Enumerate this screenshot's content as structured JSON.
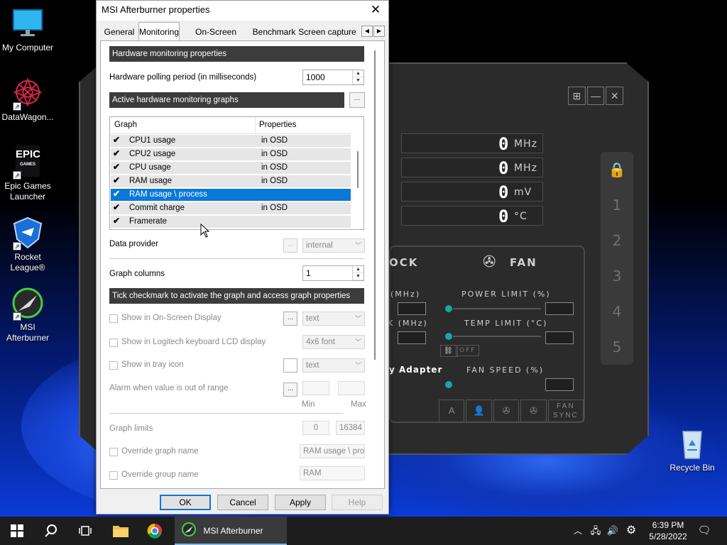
{
  "desktop": {
    "icons": [
      {
        "label": "My Computer"
      },
      {
        "label": "DataWagon..."
      },
      {
        "label": "Epic Games Launcher",
        "logo_top": "EPIC",
        "logo_bottom": "GAMES"
      },
      {
        "label": "Rocket League®"
      },
      {
        "label": "MSI Afterburner"
      },
      {
        "label": "Recycle Bin"
      }
    ]
  },
  "afterburner_skin": {
    "readouts": [
      {
        "value": "0",
        "unit": "MHz"
      },
      {
        "value": "0",
        "unit": "MHz"
      },
      {
        "value": "0",
        "unit": "mV"
      },
      {
        "value": "0",
        "unit": "°C"
      }
    ],
    "sections": {
      "clock_fragment": "OCK",
      "fan": "FAN",
      "adapter_fragment": "y Adapter"
    },
    "labels": {
      "power_limit": "POWER LIMIT (%)",
      "temp_limit": "TEMP LIMIT (°C)",
      "fan_speed": "FAN SPEED (%)",
      "mhz1": "(MHz)",
      "mhz2": "K (MHz)",
      "off": "OFF",
      "fan_sync": "FAN SYNC"
    },
    "profiles": [
      "1",
      "2",
      "3",
      "4",
      "5"
    ],
    "icon_buttons": [
      "A",
      "user-icon",
      "fan1-icon",
      "fan2-icon"
    ]
  },
  "dialog": {
    "title": "MSI Afterburner properties",
    "tabs": [
      "General",
      "Monitoring",
      "On-Screen Display",
      "Benchmark",
      "Screen capture"
    ],
    "active_tab": "Monitoring",
    "hardware_monitoring_header": "Hardware monitoring properties",
    "polling_label": "Hardware polling period (in milliseconds)",
    "polling_value": "1000",
    "active_graphs_header": "Active hardware monitoring graphs",
    "ellipsis": "...",
    "list": {
      "columns": [
        "Graph",
        "Properties"
      ],
      "rows": [
        {
          "name": "CPU1 usage",
          "prop": "in OSD",
          "checked": true
        },
        {
          "name": "CPU2 usage",
          "prop": "in OSD",
          "checked": true
        },
        {
          "name": "CPU usage",
          "prop": "in OSD",
          "checked": true
        },
        {
          "name": "RAM usage",
          "prop": "in OSD",
          "checked": true
        },
        {
          "name": "RAM usage \\ process",
          "prop": "",
          "checked": true,
          "selected": true
        },
        {
          "name": "Commit charge",
          "prop": "in OSD",
          "checked": true
        },
        {
          "name": "Framerate",
          "prop": "",
          "checked": true
        }
      ]
    },
    "data_provider_label": "Data provider",
    "data_provider_value": "internal",
    "graph_columns_label": "Graph columns",
    "graph_columns_value": "1",
    "tick_header": "Tick checkmark to activate the graph and access graph properties",
    "show_osd_label": "Show in On-Screen Display",
    "osd_type": "text",
    "show_logitech_label": "Show in Logitech keyboard LCD display",
    "logitech_font": "4x6 font",
    "show_tray_label": "Show in tray icon",
    "tray_type": "text",
    "alarm_label": "Alarm when value is out of range",
    "min_label": "Min",
    "max_label": "Max",
    "graph_limits_label": "Graph limits",
    "graph_limit_min": "0",
    "graph_limit_max": "16384",
    "override_graph_name_label": "Override graph name",
    "override_graph_name_value": "RAM usage \\ proc",
    "override_group_name_label": "Override group name",
    "override_group_name_value": "RAM",
    "buttons": {
      "ok": "OK",
      "cancel": "Cancel",
      "apply": "Apply",
      "help": "Help"
    }
  },
  "taskbar": {
    "active_app": "MSI Afterburner",
    "time": "6:39 PM",
    "date": "5/28/2022"
  },
  "colors": {
    "selection": "#0a78d7",
    "header_bar": "#3c3c3c",
    "taskbar": "#1d1d1d",
    "accent_teal": "#19a89a"
  }
}
